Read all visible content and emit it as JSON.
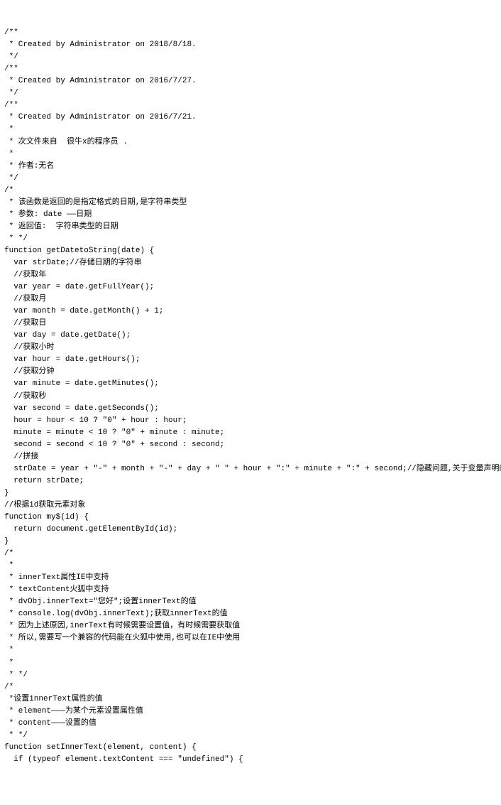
{
  "code": {
    "lines": [
      "/**",
      " * Created by Administrator on 2018/8/18.",
      " */",
      "/**",
      " * Created by Administrator on 2016/7/27.",
      " */",
      "/**",
      " * Created by Administrator on 2016/7/21.",
      " *",
      " * 次文件来自  很牛x的程序员 .",
      " *",
      " * 作者:无名",
      " */",
      "/*",
      " * 该函数是返回的是指定格式的日期,是字符串类型",
      " * 参数: date ——日期",
      " * 返回值:  字符串类型的日期",
      " * */",
      "function getDatetoString(date) {",
      "  var strDate;//存储日期的字符串",
      "  //获取年",
      "  var year = date.getFullYear();",
      "  //获取月",
      "  var month = date.getMonth() + 1;",
      "  //获取日",
      "  var day = date.getDate();",
      "  //获取小时",
      "  var hour = date.getHours();",
      "  //获取分钟",
      "  var minute = date.getMinutes();",
      "  //获取秒",
      "  var second = date.getSeconds();",
      "  hour = hour < 10 ? \"0\" + hour : hour;",
      "  minute = minute < 10 ? \"0\" + minute : minute;",
      "  second = second < 10 ? \"0\" + second : second;",
      "  //拼接",
      "  strDate = year + \"-\" + month + \"-\" + day + \" \" + hour + \":\" + minute + \":\" + second;//隐藏问题,关于变量声明的位置",
      "  return strDate;",
      "}",
      "//根据id获取元素对象",
      "function my$(id) {",
      "  return document.getElementById(id);",
      "}",
      "/*",
      " *",
      " * innerText属性IE中支持",
      " * textContent火狐中支持",
      " * dvObj.innerText=\"您好\";设置innerText的值",
      " * console.log(dvObj.innerText);获取innerText的值",
      " * 因为上述原因,inerText有时候需要设置值，有时候需要获取值",
      " * 所以,需要写一个兼容的代码能在火狐中使用,也可以在IE中使用",
      " *",
      " *",
      " * */",
      "/*",
      " *设置innerText属性的值",
      " * element———为某个元素设置属性值",
      " * content———设置的值",
      " * */",
      "function setInnerText(element, content) {",
      "  if (typeof element.textContent === \"undefined\") {"
    ]
  }
}
